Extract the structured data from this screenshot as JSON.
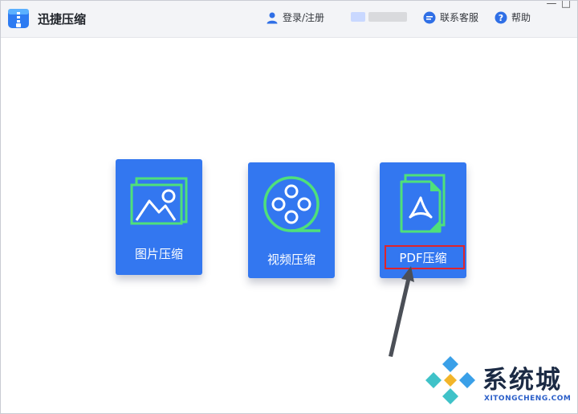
{
  "app": {
    "title": "迅捷压缩"
  },
  "header": {
    "login_label": "登录/注册",
    "service_label": "联系客服",
    "help_label": "帮助"
  },
  "window_controls": {
    "minimize": "—",
    "maximize": "□"
  },
  "cards": {
    "image": {
      "label": "图片压缩"
    },
    "video": {
      "label": "视频压缩"
    },
    "pdf": {
      "label": "PDF压缩"
    }
  },
  "watermark": {
    "title": "系统城",
    "subtitle": "XITONGCHENG.COM"
  },
  "colors": {
    "card_blue": "#3377f0",
    "icon_green": "#4fe07a",
    "highlight_red": "#e0242a"
  }
}
